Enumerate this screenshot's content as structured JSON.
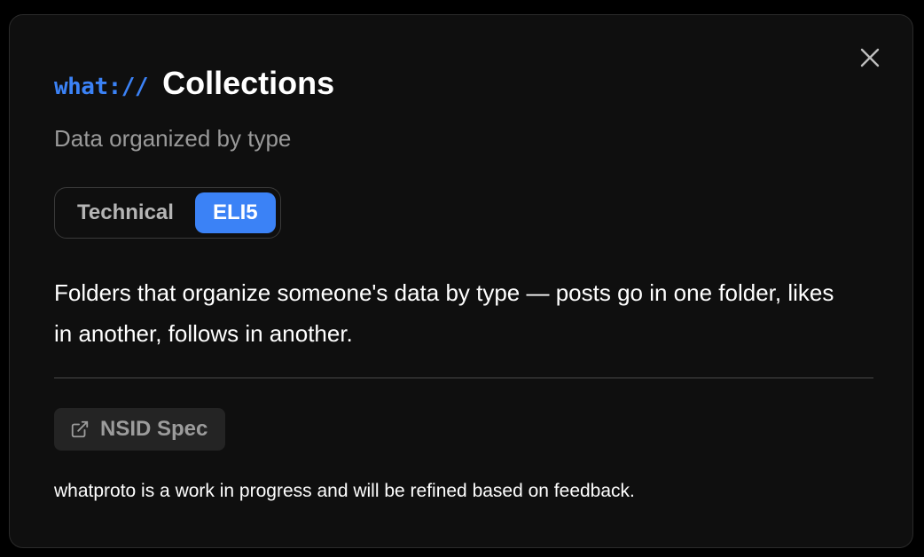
{
  "dialog": {
    "prefix": "what://",
    "title": "Collections",
    "subtitle": "Data organized by type",
    "toggle": {
      "options": [
        "Technical",
        "ELI5"
      ],
      "selected": "ELI5"
    },
    "description": "Folders that organize someone's data by type — posts go in one folder, likes in another, follows in another.",
    "link_label": "NSID Spec",
    "footer": "whatproto is a work in progress and will be refined based on feedback."
  },
  "icons": {
    "close": "close-icon",
    "external_link": "external-link-icon"
  },
  "colors": {
    "accent": "#3b82f6",
    "background": "#0f0f0f"
  }
}
